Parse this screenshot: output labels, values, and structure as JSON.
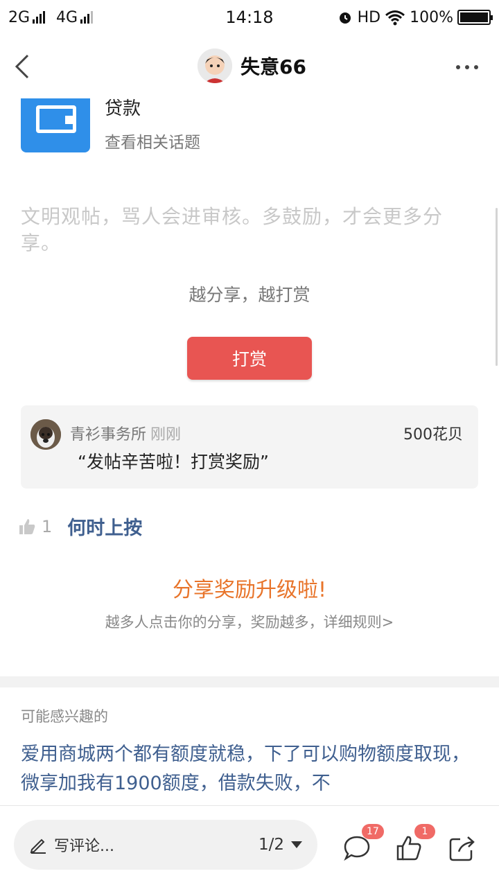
{
  "status_bar": {
    "network1": "2G",
    "network2": "4G",
    "time": "14:18",
    "hd": "HD",
    "battery": "100%"
  },
  "nav": {
    "username": "失意66"
  },
  "topic": {
    "title": "贷款",
    "subtitle": "查看相关话题"
  },
  "civility_notice": "文明观帖，骂人会进审核。多鼓励，才会更多分享。",
  "reward": {
    "slogan": "越分享，越打赏",
    "button_label": "打赏"
  },
  "tip": {
    "user": "青衫事务所",
    "time": "刚刚",
    "amount": "500花贝",
    "message": "“发帖辛苦啦！打赏奖励”"
  },
  "likes": {
    "count": "1",
    "title": "何时上按"
  },
  "share_upgrade": {
    "title": "分享奖励升级啦!",
    "subtitle": "越多人点击你的分享，奖励越多，详细规则>"
  },
  "interest": {
    "label": "可能感兴趣的",
    "text": "爱用商城两个都有额度就稳，下了可以购物额度取现，微享加我有1900额度，借款失败，不"
  },
  "bottom_bar": {
    "comment_placeholder": "写评论...",
    "page_indicator": "1/2",
    "comment_badge": "17",
    "like_badge": "1"
  },
  "colors": {
    "accent_red": "#e85552",
    "link_blue": "#3f5f8f",
    "orange": "#e8742a"
  }
}
